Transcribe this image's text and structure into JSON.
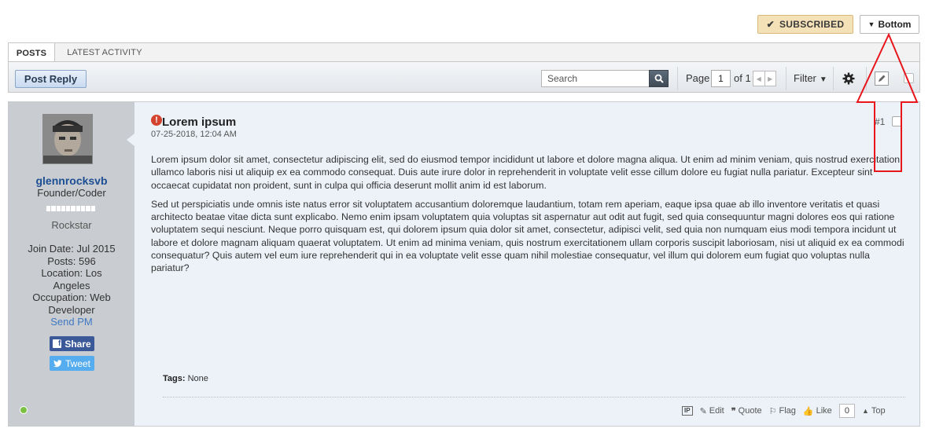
{
  "top_buttons": {
    "subscribed_label": "SUBSCRIBED",
    "bottom_label": "Bottom"
  },
  "tabs": [
    {
      "label": "POSTS",
      "active": true
    },
    {
      "label": "LATEST ACTIVITY",
      "active": false
    }
  ],
  "toolbar": {
    "post_reply_label": "Post Reply",
    "search_placeholder": "Search",
    "page_label": "Page",
    "page_value": "1",
    "of_label": "of 1",
    "filter_label": "Filter"
  },
  "user": {
    "username": "glennrocksvb",
    "title": "Founder/Coder",
    "rank": "Rockstar",
    "join_date": "Join Date: Jul 2015",
    "posts": "Posts: 596",
    "location": "Location: Los Angeles",
    "occupation": "Occupation: Web Developer",
    "send_pm": "Send PM",
    "share_label": "Share",
    "tweet_label": "Tweet",
    "online_color": "#7ac143"
  },
  "post": {
    "title": "Lorem ipsum",
    "date": "07-25-2018, 12:04 AM",
    "number": "#1",
    "paragraphs": [
      "Lorem ipsum dolor sit amet, consectetur adipiscing elit, sed do eiusmod tempor incididunt ut labore et dolore magna aliqua. Ut enim ad minim veniam, quis nostrud exercitation ullamco laboris nisi ut aliquip ex ea commodo consequat. Duis aute irure dolor in reprehenderit in voluptate velit esse cillum dolore eu fugiat nulla pariatur. Excepteur sint occaecat cupidatat non proident, sunt in culpa qui officia deserunt mollit anim id est laborum.",
      "Sed ut perspiciatis unde omnis iste natus error sit voluptatem accusantium doloremque laudantium, totam rem aperiam, eaque ipsa quae ab illo inventore veritatis et quasi architecto beatae vitae dicta sunt explicabo. Nemo enim ipsam voluptatem quia voluptas sit aspernatur aut odit aut fugit, sed quia consequuntur magni dolores eos qui ratione voluptatem sequi nesciunt. Neque porro quisquam est, qui dolorem ipsum quia dolor sit amet, consectetur, adipisci velit, sed quia non numquam eius modi tempora incidunt ut labore et dolore magnam aliquam quaerat voluptatem. Ut enim ad minima veniam, quis nostrum exercitationem ullam corporis suscipit laboriosam, nisi ut aliquid ex ea commodi consequatur? Quis autem vel eum iure reprehenderit qui in ea voluptate velit esse quam nihil molestiae consequatur, vel illum qui dolorem eum fugiat quo voluptas nulla pariatur?"
    ],
    "tags_label": "Tags:",
    "tags_value": "None",
    "actions": {
      "ip": "IP",
      "edit": "Edit",
      "quote": "Quote",
      "flag": "Flag",
      "like": "Like",
      "like_count": "0",
      "top": "Top"
    }
  },
  "colors": {
    "accent_subscribed": "#f5e1b8",
    "link": "#1c4e94",
    "annotation_arrow": "#e8151c"
  }
}
